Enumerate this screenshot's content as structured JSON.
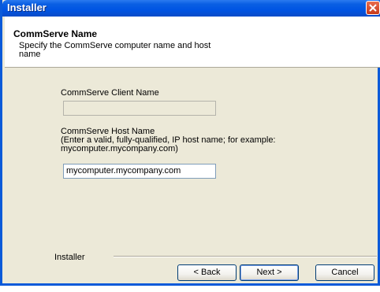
{
  "window": {
    "title": "Installer"
  },
  "header": {
    "title": "CommServe Name",
    "subtitle": "Specify the CommServe computer name and host name"
  },
  "form": {
    "client_name_label": "CommServe Client Name",
    "client_name_value": "",
    "host_name_label_line1": "CommServe Host Name",
    "host_name_label_line2": "(Enter a valid, fully-qualified, IP host name; for example:",
    "host_name_label_line3": "mycomputer.mycompany.com)",
    "host_name_value": "mycomputer.mycompany.com"
  },
  "footer": {
    "label": "Installer",
    "back_label": "< Back",
    "next_label": "Next >",
    "cancel_label": "Cancel"
  },
  "icons": {
    "close": "close-icon"
  },
  "colors": {
    "titlebar": "#0054e3",
    "dialog_bg": "#ece9d8",
    "close_button": "#c7391b"
  }
}
